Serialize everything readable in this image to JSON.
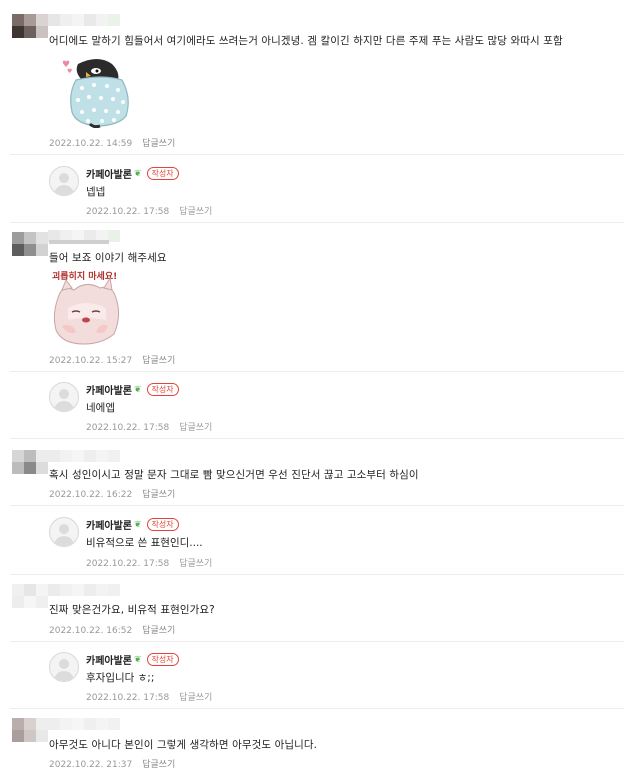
{
  "comments": [
    {
      "text": "어디에도 말하기 힘들어서 여기에라도 쓰려는거 아니겠녕. 겜 칼이긴 하지만 다른 주제 푸는 사람도 많당 와따시 포함",
      "date": "2022.10.22. 14:59",
      "reply_label": "답글쓰기",
      "sticker": "penguin-in-blanket-sticker",
      "reply": {
        "author": "카페아발론",
        "badge": "작성자",
        "text": "넵넵",
        "date": "2022.10.22. 17:58",
        "reply_label": "답글쓰기"
      }
    },
    {
      "text": "들어 보죠 이야기 해주세요",
      "date": "2022.10.22. 15:27",
      "reply_label": "답글쓰기",
      "sticker": "괴롭히지 마세요!",
      "reply": {
        "author": "카페아발론",
        "badge": "작성자",
        "text": "네에엡",
        "date": "2022.10.22. 17:58",
        "reply_label": "답글쓰기"
      }
    },
    {
      "text": "혹시 성인이시고 정말 문자 그대로 빰 맞으신거면 우선 진단서 끊고 고소부터 하심이",
      "date": "2022.10.22. 16:22",
      "reply_label": "답글쓰기",
      "reply": {
        "author": "카페아발론",
        "badge": "작성자",
        "text": "비유적으로 쓴 표현인디....",
        "date": "2022.10.22. 17:58",
        "reply_label": "답글쓰기"
      }
    },
    {
      "text": "진짜 맞은건가요, 비유적 표현인가요?",
      "date": "2022.10.22. 16:52",
      "reply_label": "답글쓰기",
      "reply": {
        "author": "카페아발론",
        "badge": "작성자",
        "text": "후자입니다 ㅎ;;",
        "date": "2022.10.22. 17:58",
        "reply_label": "답글쓰기"
      }
    },
    {
      "text": "아무것도 아니다 본인이 그렇게 생각하면 아무것도 아닙니다.",
      "date": "2022.10.22. 21:37",
      "reply_label": "답글쓰기"
    }
  ]
}
